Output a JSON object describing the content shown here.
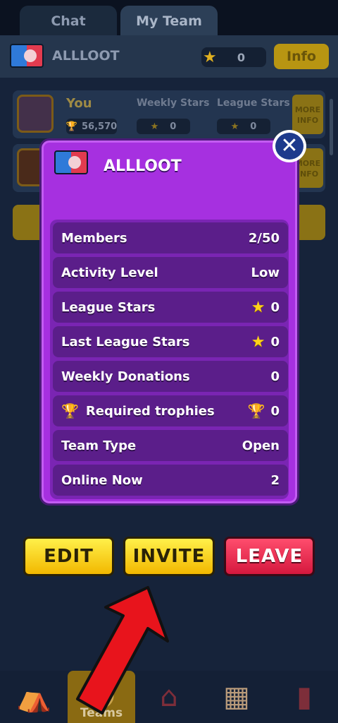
{
  "tabs": {
    "chat": "Chat",
    "my_team": "My Team"
  },
  "header": {
    "team_name": "ALLLOOT",
    "stars": "0",
    "info_label": "Info"
  },
  "member_row": {
    "you_label": "You",
    "trophies": "56,570",
    "weekly_stars_label": "Weekly Stars",
    "weekly_stars": "0",
    "league_stars_label": "League Stars",
    "league_stars": "0",
    "more_info_label": "MORE INFO"
  },
  "modal": {
    "team_name": "ALLLOOT",
    "stats": [
      {
        "label": "Members",
        "value": "2/50",
        "icon": ""
      },
      {
        "label": "Activity Level",
        "value": "Low",
        "icon": ""
      },
      {
        "label": "League Stars",
        "value": "0",
        "icon": "star"
      },
      {
        "label": "Last League Stars",
        "value": "0",
        "icon": "star"
      },
      {
        "label": "Weekly Donations",
        "value": "0",
        "icon": ""
      },
      {
        "label": "Required trophies",
        "value": "0",
        "icon": "trophy"
      },
      {
        "label": "Team Type",
        "value": "Open",
        "icon": ""
      },
      {
        "label": "Online Now",
        "value": "2",
        "icon": ""
      }
    ]
  },
  "actions": {
    "edit": "EDIT",
    "invite": "INVITE",
    "leave": "LEAVE"
  },
  "bottom_nav": {
    "teams_label": "Teams"
  },
  "colors": {
    "modal_bg": "#a630e0",
    "yellow_btn": "#f2b800",
    "red_btn": "#d5183e",
    "arrow": "#e8141c"
  }
}
